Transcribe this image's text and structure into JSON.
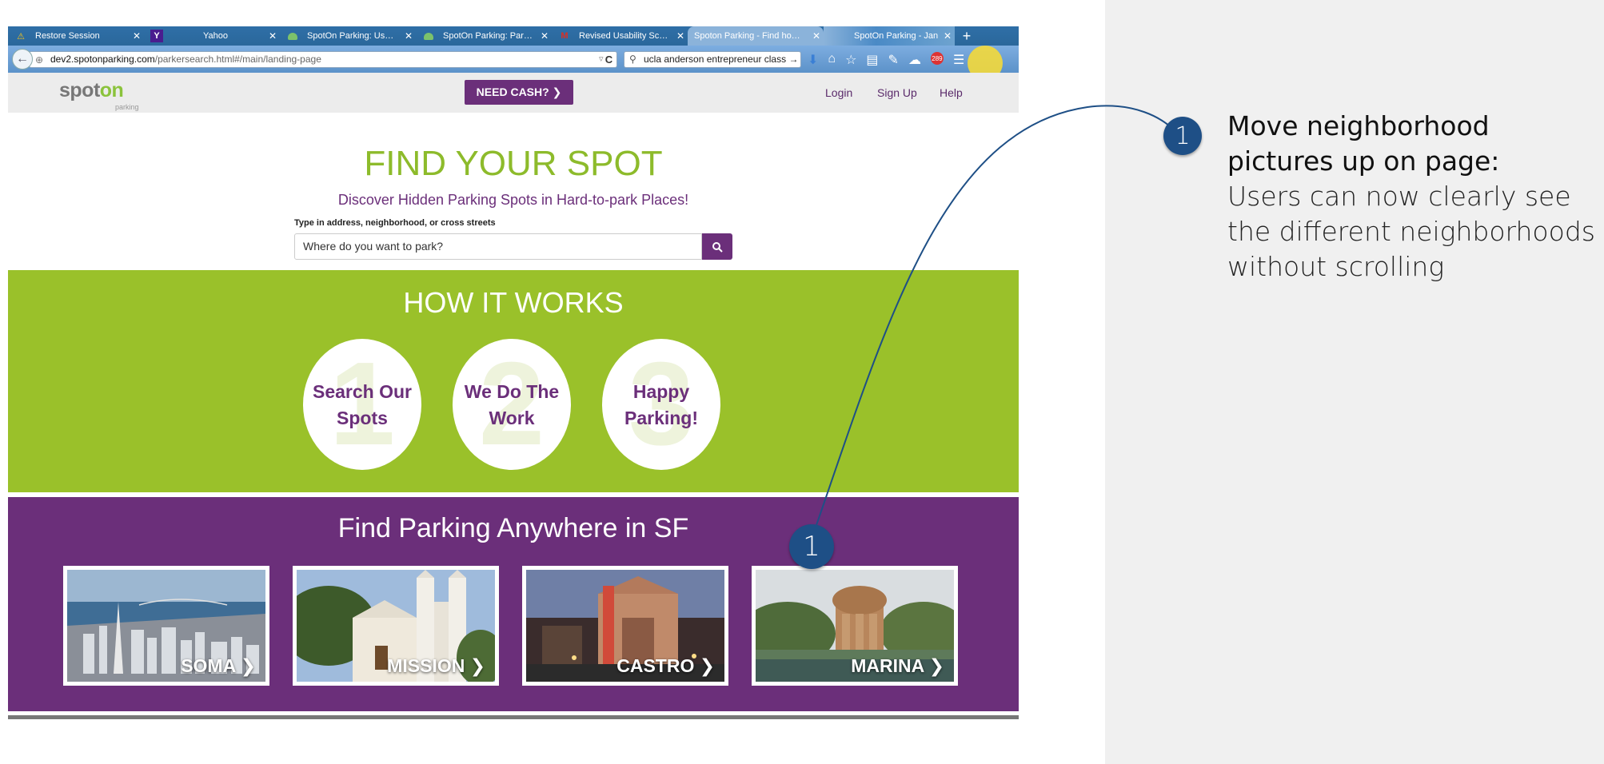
{
  "browser": {
    "tabs": [
      {
        "label": "Restore Session",
        "icon": "warning-icon",
        "active": false
      },
      {
        "label": "Yahoo",
        "icon": "yahoo-icon",
        "active": false
      },
      {
        "label": "SpotOn Parking: Us…",
        "icon": "spoton-icon",
        "active": false
      },
      {
        "label": "SpotOn Parking: Par…",
        "icon": "spoton-icon",
        "active": false
      },
      {
        "label": "Revised Usability Sc…",
        "icon": "gmail-icon",
        "active": false
      },
      {
        "label": "Spoton Parking - Find ho…",
        "icon": "",
        "active": true
      },
      {
        "label": "SpotOn Parking - Jan …",
        "icon": "",
        "active": false
      }
    ],
    "url_host": "dev2.spotonparking.com",
    "url_path": "/parkersearch.html#/main/landing-page",
    "search_value": "ucla anderson entrepreneur class",
    "badge_count": "289"
  },
  "site": {
    "logo_text": "spot",
    "logo_accent": "on",
    "logo_sub": "parking",
    "cash_button": "NEED CASH? ❯",
    "nav": [
      "Login",
      "Sign Up",
      "Help"
    ],
    "hero_title": "FIND YOUR SPOT",
    "hero_subtitle": "Discover Hidden Parking Spots in Hard-to-park Places!",
    "search_label": "Type in address, neighborhood, or cross streets",
    "search_placeholder": "Where do you want to park?",
    "how_title": "HOW IT WORKS",
    "steps": [
      {
        "num": "1",
        "line1": "Search Our",
        "line2": "Spots"
      },
      {
        "num": "2",
        "line1": "We Do The",
        "line2": "Work"
      },
      {
        "num": "3",
        "line1": "Happy",
        "line2": "Parking!"
      }
    ],
    "neighborhoods_title": "Find Parking Anywhere in SF",
    "neighborhoods": [
      "SOMA ❯",
      "MISSION ❯",
      "CASTRO ❯",
      "MARINA ❯"
    ],
    "marker_number": "1"
  },
  "annotation": {
    "number": "1",
    "title": "Move neighborhood pictures up on page:",
    "body": "Users can now clearly see the different neighborhoods without scrolling"
  },
  "colors": {
    "brand_purple": "#6b2f7a",
    "brand_green": "#9ac12a",
    "marker_blue": "#1e4f86"
  }
}
